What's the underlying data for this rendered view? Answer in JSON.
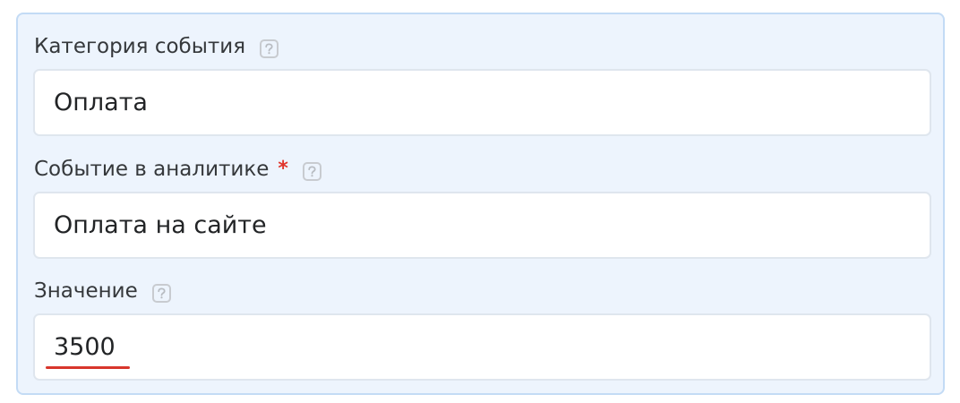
{
  "form": {
    "category": {
      "label": "Категория события",
      "value": "Оплата"
    },
    "event": {
      "label": "Событие в аналитике",
      "required_mark": "*",
      "value": "Оплата на сайте"
    },
    "value_field": {
      "label": "Значение",
      "value": "3500"
    },
    "help_icon": "question-mark-icon"
  },
  "colors": {
    "panel_background": "#edf4fd",
    "panel_border": "#c3dbf5",
    "required": "#e0342b",
    "spellcheck_underline": "#d8362c"
  }
}
